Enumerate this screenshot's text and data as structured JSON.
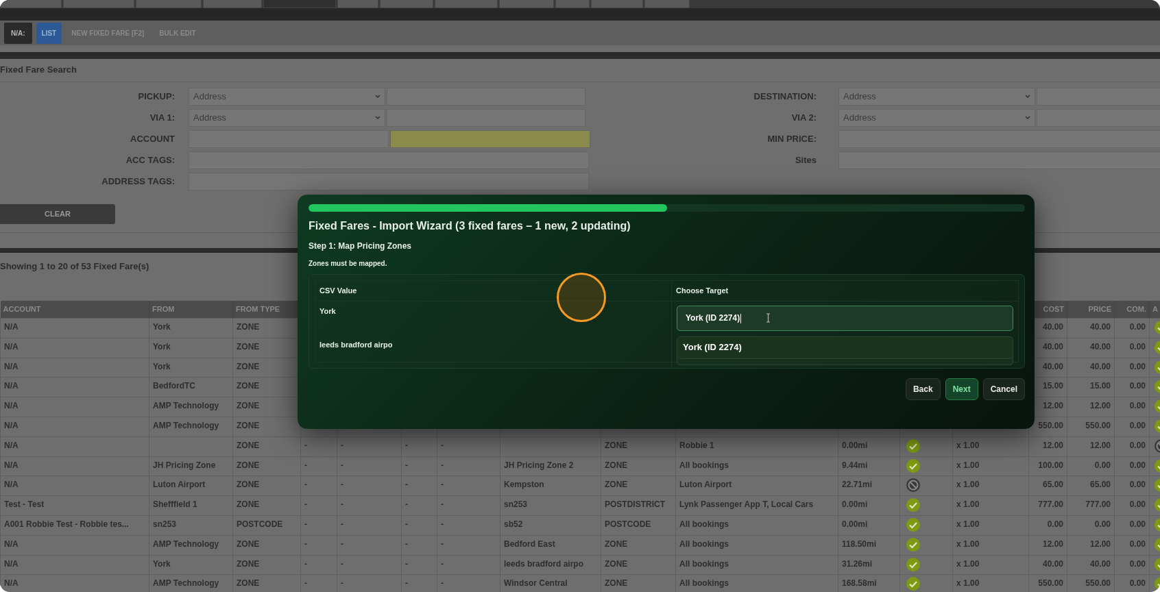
{
  "top_tabs": [
    {
      "selected": false
    },
    {
      "selected": false
    },
    {
      "selected": false
    },
    {
      "selected": false
    },
    {
      "selected": true
    },
    {
      "selected": false
    },
    {
      "selected": false
    },
    {
      "selected": false
    },
    {
      "selected": false
    },
    {
      "selected": false
    },
    {
      "selected": false
    },
    {
      "selected": false
    }
  ],
  "toolbar": {
    "badge": "N/A:",
    "buttons": [
      {
        "label": "LIST",
        "selected": true
      },
      {
        "label": "NEW FIXED FARE [F2]",
        "selected": false
      },
      {
        "label": "BULK EDIT",
        "selected": false
      }
    ]
  },
  "search": {
    "title": "Fixed Fare Search",
    "left": [
      {
        "label": "PICKUP:",
        "kind": "select-input",
        "value": "Address"
      },
      {
        "label": "VIA 1:",
        "kind": "select-input",
        "value": "Address"
      },
      {
        "label": "ACCOUNT",
        "kind": "double-input"
      },
      {
        "label": "ACC TAGS:",
        "kind": "input"
      },
      {
        "label": "ADDRESS TAGS:",
        "kind": "input"
      }
    ],
    "right": [
      {
        "label": "DESTINATION:",
        "kind": "select-input",
        "value": "Address"
      },
      {
        "label": "VIA 2:",
        "kind": "select-input",
        "value": "Address"
      },
      {
        "label": "MIN PRICE:",
        "kind": "input"
      },
      {
        "label": "Sites",
        "kind": "input"
      }
    ],
    "clear_button": "CLEAR"
  },
  "summary": "Showing 1 to 20 of 53 Fixed Fare(s)",
  "table": {
    "columns": [
      "ACCOUNT",
      "FROM",
      "FROM TYPE",
      "",
      "",
      "",
      "",
      "",
      "",
      "",
      "",
      "",
      "",
      "COST",
      "PRICE",
      "COM.",
      "A"
    ],
    "rows": [
      {
        "account": "N/A",
        "from": "York",
        "from_type": "ZONE",
        "cost": "40.00",
        "price": "40.00",
        "com": "0.00",
        "check_2": true
      },
      {
        "account": "N/A",
        "from": "York",
        "from_type": "ZONE",
        "cost": "40.00",
        "price": "40.00",
        "com": "0.00",
        "check_2": true
      },
      {
        "account": "N/A",
        "from": "York",
        "from_type": "ZONE",
        "cost": "40.00",
        "price": "40.00",
        "com": "0.00",
        "check_2": true
      },
      {
        "account": "N/A",
        "from": "BedfordTC",
        "from_type": "ZONE",
        "cost": "15.00",
        "price": "15.00",
        "com": "0.00",
        "check_2": true
      },
      {
        "account": "N/A",
        "from": "AMP Technology",
        "from_type": "ZONE",
        "cost": "12.00",
        "price": "12.00",
        "com": "0.00",
        "check_2": true
      },
      {
        "account": "N/A",
        "from": "AMP Technology",
        "from_type": "ZONE",
        "cost": "550.00",
        "price": "550.00",
        "com": "0.00",
        "check_2": true
      },
      {
        "account": "N/A",
        "from_type": "ZONE",
        "c4": "-",
        "c5": "-",
        "c6": "-",
        "c7": "-",
        "to_type": "ZONE",
        "sites": "Robbie 1",
        "distance": "0.00mi",
        "check_1": true,
        "multiplier": "x 1.00",
        "cost": "12.00",
        "price": "12.00",
        "com": "0.00",
        "check_2": false
      },
      {
        "account": "N/A",
        "from": "JH Pricing Zone",
        "from_type": "ZONE",
        "c4": "-",
        "c5": "-",
        "c6": "-",
        "c7": "-",
        "to": "JH Pricing Zone 2",
        "to_type": "ZONE",
        "sites": "All bookings",
        "distance": "9.44mi",
        "check_1": true,
        "multiplier": "x 1.00",
        "cost": "100.00",
        "price": "0.00",
        "com": "0.00",
        "check_2": true
      },
      {
        "account": "N/A",
        "from": "Luton Airport",
        "from_type": "ZONE",
        "c4": "-",
        "c5": "-",
        "c6": "-",
        "c7": "-",
        "to": "Kempston",
        "to_type": "ZONE",
        "sites": "Luton Airport",
        "distance": "22.71mi",
        "check_1": false,
        "multiplier": "x 1.00",
        "cost": "65.00",
        "price": "65.00",
        "com": "0.00",
        "check_2": true
      },
      {
        "account": "Test - Test",
        "from": "Shefffield 1",
        "from_type": "ZONE",
        "c4": "-",
        "c5": "-",
        "c6": "-",
        "c7": "-",
        "to": "sn253",
        "to_type": "POSTDISTRICT",
        "sites": "Lynk Passenger App T, Local Cars",
        "distance": "0.00mi",
        "check_1": true,
        "multiplier": "x 1.00",
        "cost": "777.00",
        "price": "777.00",
        "com": "0.00",
        "check_2": true
      },
      {
        "account": "A001 Robbie Test - Robbie tes...",
        "from": "sn253",
        "from_type": "POSTCODE",
        "c4": "-",
        "c5": "-",
        "c6": "-",
        "c7": "-",
        "to": "sb52",
        "to_type": "POSTCODE",
        "sites": "All bookings",
        "distance": "0.00mi",
        "check_1": true,
        "multiplier": "x 1.00",
        "cost": "0.00",
        "price": "0.00",
        "com": "0.00",
        "check_2": true
      },
      {
        "account": "N/A",
        "from": "AMP Technology",
        "from_type": "ZONE",
        "c4": "-",
        "c5": "-",
        "c6": "-",
        "c7": "-",
        "to": "Bedford East",
        "to_type": "ZONE",
        "sites": "All bookings",
        "distance": "118.50mi",
        "check_1": true,
        "multiplier": "x 1.00",
        "cost": "12.00",
        "price": "12.00",
        "com": "0.00",
        "check_2": true
      },
      {
        "account": "N/A",
        "from": "York",
        "from_type": "ZONE",
        "c4": "-",
        "c5": "-",
        "c6": "-",
        "c7": "-",
        "to": "leeds bradford airpo",
        "to_type": "ZONE",
        "sites": "All bookings",
        "distance": "31.26mi",
        "check_1": true,
        "multiplier": "x 1.00",
        "cost": "40.00",
        "price": "40.00",
        "com": "0.00",
        "check_2": true
      },
      {
        "account": "N/A",
        "from": "AMP Technology",
        "from_type": "ZONE",
        "c4": "-",
        "c5": "-",
        "c6": "-",
        "c7": "-",
        "to": "Windsor Central",
        "to_type": "ZONE",
        "sites": "All bookings",
        "distance": "168.58mi",
        "check_1": true,
        "multiplier": "x 1.00",
        "cost": "550.00",
        "price": "550.00",
        "com": "0.00",
        "check_2": true
      }
    ]
  },
  "wizard": {
    "progress": {
      "level": 0.5
    },
    "title": "Fixed Fares - Import Wizard (3 fixed fares – 1 new, 2 updating)",
    "step": "Step 1: Map Pricing Zones",
    "note": "Zones must be mapped.",
    "mapping": {
      "columns": [
        "CSV Value",
        "Choose Target"
      ],
      "rows": [
        {
          "csv_value": "York",
          "target": "York (ID 2274)",
          "kind": "input"
        },
        {
          "csv_value": "leeds bradford airpo",
          "option": "York (ID 2274)",
          "kind": "dropdown"
        }
      ]
    },
    "buttons": [
      {
        "label": "Back",
        "primary": false
      },
      {
        "label": "Next",
        "primary": true
      },
      {
        "label": "Cancel",
        "primary": false
      }
    ]
  }
}
